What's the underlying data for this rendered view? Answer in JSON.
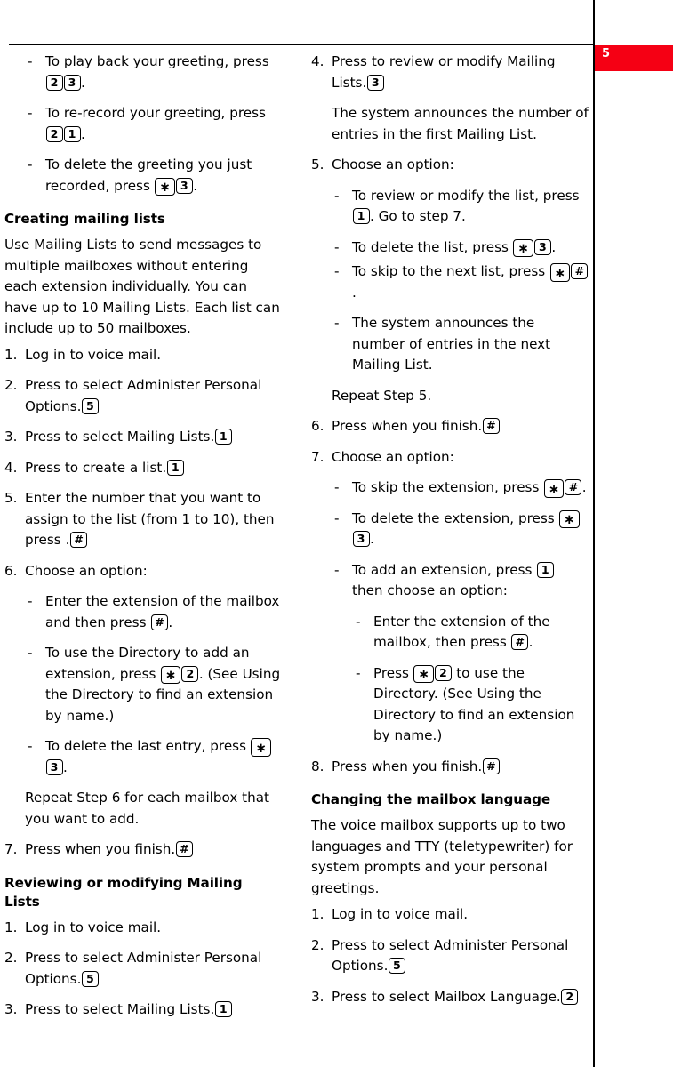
{
  "page": {
    "tab_number": "5",
    "tab_color": "#f50014"
  },
  "left_column": {
    "blocks": [
      {
        "kind": "dash",
        "id": "play-back-greeting",
        "text_1": "To play back your greeting,",
        "text_2": "press ",
        "key_a": "2",
        "key_b": "3",
        "text_3": "."
      },
      {
        "kind": "dash",
        "id": "re-record-greeting",
        "text_1": "To re-record your greeting,",
        "text_2": "press ",
        "key_a": "2",
        "key_b": "1",
        "text_3": "."
      },
      {
        "kind": "dash",
        "id": "delete-greeting",
        "text_1": "To delete the greeting you just",
        "text_2": "recorded, press ",
        "key_a": "*",
        "key_b": "3",
        "text_3": "."
      },
      {
        "kind": "h2",
        "id": "creating-mailing-lists",
        "text": "Creating mailing lists"
      },
      {
        "kind": "para",
        "id": "mailing-lists-intro",
        "text": "Use Mailing Lists to send messages to multiple mailboxes without entering each extension individually. You can have up to 10 Mailing Lists. Each list can include up to 50 mailboxes."
      },
      {
        "kind": "step",
        "id": "create-step-1",
        "num": "1.",
        "text_1": "Log in to voice mail."
      },
      {
        "kind": "step",
        "id": "create-step-2",
        "num": "2.",
        "text_1": "Press ",
        "key_a": "5",
        "text_2": " to select Administer Personal Options."
      },
      {
        "kind": "step",
        "id": "create-step-3",
        "num": "3.",
        "text_1": "Press ",
        "key_a": "1",
        "text_2": " to select Mailing Lists."
      },
      {
        "kind": "step",
        "id": "create-step-4",
        "num": "4.",
        "text_1": "Press ",
        "key_a": "1",
        "text_2": " to create a list."
      },
      {
        "kind": "step",
        "id": "create-step-5",
        "num": "5.",
        "text_1": "Enter the number that you want to assign to the list (from 1 to 10), then press ",
        "key_a": "#",
        "text_2": "."
      },
      {
        "kind": "step",
        "id": "create-step-6",
        "num": "6.",
        "text_1": "Choose an option:"
      },
      {
        "kind": "dash",
        "id": "enter-extension-mailbox",
        "text_1": "Enter the extension of the mailbox",
        "text_2": "and then press ",
        "key_a": "#",
        "text_3": "."
      },
      {
        "kind": "dash",
        "id": "use-directory-add",
        "text_1": "To use the Directory to add an",
        "text_2": "extension, press ",
        "key_a": "*",
        "key_b": "2",
        "text_3": ". (See Using the Directory to find an extension by name.)"
      },
      {
        "kind": "dash",
        "id": "delete-last-entry",
        "text_1": "To delete the last entry,",
        "text_2": "press ",
        "key_a": "*",
        "key_b": "3",
        "text_3": "."
      },
      {
        "kind": "step-cont",
        "id": "repeat-step-6",
        "text": "Repeat Step 6 for each mailbox that you want to add."
      },
      {
        "kind": "step",
        "id": "create-step-7",
        "num": "7.",
        "text_1": "Press ",
        "key_a": "#",
        "text_2": " when you finish."
      },
      {
        "kind": "h2",
        "id": "reviewing-modifying-mailing-lists",
        "text": "Reviewing or modifying Mailing Lists"
      },
      {
        "kind": "step",
        "id": "review-step-1",
        "num": "1.",
        "text_1": "Log in to voice mail."
      },
      {
        "kind": "step",
        "id": "review-step-2",
        "num": "2.",
        "text_1": "Press ",
        "key_a": "5",
        "text_2": " to select Administer Personal Options."
      },
      {
        "kind": "step",
        "id": "review-step-3",
        "num": "3.",
        "text_1": "Press ",
        "key_a": "1",
        "text_2": " to select Mailing Lists."
      }
    ]
  },
  "right_column": {
    "blocks": [
      {
        "kind": "step",
        "id": "review-step-4",
        "num": "4.",
        "text_1": "Press ",
        "key_a": "3",
        "text_2": " to review or modify Mailing Lists."
      },
      {
        "kind": "step-cont",
        "id": "system-announces-first",
        "text": "The system announces the number of entries in the first Mailing List."
      },
      {
        "kind": "step",
        "id": "review-step-5",
        "num": "5.",
        "text_1": "Choose an option:"
      },
      {
        "kind": "dash",
        "id": "review-or-modify-list",
        "text_1": "To review or modify the list,",
        "text_2": "press ",
        "key_a": "1",
        "text_3": ". Go to step 7."
      },
      {
        "kind": "dash",
        "id": "delete-the-list",
        "tight": true,
        "text_2": "To delete the list, press ",
        "key_a": "*",
        "key_b": "3",
        "text_3": "."
      },
      {
        "kind": "dash",
        "id": "skip-to-next-list",
        "text_1": "To skip to the next list,",
        "text_2": "press ",
        "key_a": "*",
        "key_b": "#",
        "text_3": "."
      },
      {
        "kind": "dash",
        "id": "system-announces-next",
        "text_1": "The system announces the number of entries in the next Mailing List."
      },
      {
        "kind": "step-cont",
        "id": "repeat-step-5",
        "text": "Repeat Step 5."
      },
      {
        "kind": "step",
        "id": "review-step-6",
        "num": "6.",
        "text_1": "Press ",
        "key_a": "#",
        "text_2": " when you finish."
      },
      {
        "kind": "step",
        "id": "review-step-7",
        "num": "7.",
        "text_1": "Choose an option:"
      },
      {
        "kind": "dash",
        "id": "skip-the-extension",
        "text_1": "To skip the extension,",
        "text_2": "press ",
        "key_a": "*",
        "key_b": "#",
        "text_3": "."
      },
      {
        "kind": "dash",
        "id": "delete-the-extension",
        "text_1": "To delete the extension,",
        "text_2": "press ",
        "key_a": "*",
        "key_b": "3",
        "text_3": "."
      },
      {
        "kind": "dash",
        "id": "add-an-extension",
        "text_2": "To add an extension, press ",
        "key_a": "1",
        "text_3": " then choose an option:"
      },
      {
        "kind": "dash2",
        "id": "enter-extension-then-hash",
        "text_1": "Enter the extension of the",
        "text_2": "mailbox, then press ",
        "key_a": "#",
        "text_3": "."
      },
      {
        "kind": "dash2",
        "id": "press-star-2-directory",
        "text_2": "Press ",
        "key_a": "*",
        "key_b": "2",
        "text_3": " to use the Directory. (See Using the Directory to find an extension by name.)"
      },
      {
        "kind": "step",
        "id": "review-step-8",
        "num": "8.",
        "text_1": "Press ",
        "key_a": "#",
        "text_2": " when you finish."
      },
      {
        "kind": "h2",
        "id": "changing-the-mailbox-language",
        "text": "Changing the mailbox language"
      },
      {
        "kind": "para",
        "id": "mailbox-language-intro",
        "text": "The voice mailbox supports up to two languages and TTY (teletypewriter) for system prompts and your personal greetings."
      },
      {
        "kind": "step",
        "id": "language-step-1",
        "num": "1.",
        "text_1": "Log in to voice mail."
      },
      {
        "kind": "step",
        "id": "language-step-2",
        "num": "2.",
        "text_1": "Press ",
        "key_a": "5",
        "text_2": " to select Administer Personal Options."
      },
      {
        "kind": "step",
        "id": "language-step-3",
        "num": "3.",
        "text_1": "Press ",
        "key_a": "2",
        "text_2": " to select Mailbox Language."
      }
    ]
  }
}
